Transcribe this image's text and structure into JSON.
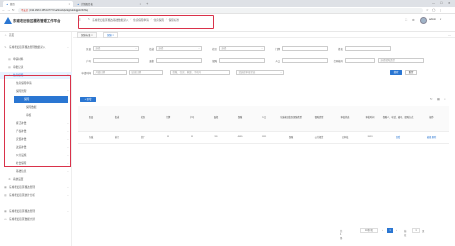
{
  "browser": {
    "tabs": [
      {
        "title": "首页",
        "active": true
      },
      {
        "title": "计划配台表",
        "active": false
      }
    ],
    "url_insecure": "不安全",
    "url": "192.168.0.155:10777/zxahbx/dqh/dqjzsk/dqjgsh/zbhhq"
  },
  "app": {
    "title": "东城老旧街区棚改管理工作平台",
    "breadcrumb": [
      "东城老旧街区棚改基础数据录入",
      "住房保障申请",
      "住房保障",
      "保障标准"
    ],
    "user": "admin"
  },
  "sidebar": {
    "items": [
      {
        "label": "首页",
        "icon": "home-icon",
        "level": 0,
        "state": ""
      },
      {
        "label": "东城老旧街区棚改管理数据录入",
        "icon": "edit-icon",
        "level": 0,
        "state": "",
        "chevron": "⌄"
      },
      {
        "label": "申请材料",
        "icon": "doc-icon",
        "level": 1,
        "state": ""
      },
      {
        "label": "审批记录",
        "icon": "doc-icon",
        "level": 1,
        "state": ""
      },
      {
        "label": "住房保障",
        "icon": "house-icon",
        "level": 1,
        "state": "active",
        "chevron": "⌃"
      },
      {
        "label": "住房保障申请",
        "icon": "",
        "level": 2,
        "state": ""
      },
      {
        "label": "保障管理",
        "icon": "",
        "level": 2,
        "state": "",
        "chevron": "⌃"
      },
      {
        "label": "保障",
        "icon": "",
        "level": 3,
        "state": "activeleaf"
      },
      {
        "label": "保障数据",
        "icon": "",
        "level": 3,
        "state": ""
      },
      {
        "label": "审核",
        "icon": "",
        "level": 3,
        "state": ""
      },
      {
        "label": "拆迁补偿",
        "icon": "",
        "level": 2,
        "state": "",
        "chevron": "⌄"
      },
      {
        "label": "产权补偿",
        "icon": "",
        "level": 2,
        "state": "",
        "chevron": "⌄"
      },
      {
        "label": "安置补偿",
        "icon": "",
        "level": 2,
        "state": "",
        "chevron": "⌄"
      },
      {
        "label": "改造补偿",
        "icon": "",
        "level": 2,
        "state": "",
        "chevron": "⌄"
      },
      {
        "label": "公共设施",
        "icon": "",
        "level": 2,
        "state": "",
        "chevron": "⌄"
      },
      {
        "label": "社会保障",
        "icon": "",
        "level": 2,
        "state": "",
        "chevron": "⌄"
      },
      {
        "label": "基础信息",
        "icon": "",
        "level": 2,
        "state": "",
        "chevron": "⌄"
      },
      {
        "label": "系统设置",
        "icon": "gear-icon",
        "level": 1,
        "state": ""
      },
      {
        "label": "东城老旧街区棚改管理",
        "icon": "grid-icon",
        "level": 0,
        "state": "",
        "chevron": "⌄"
      },
      {
        "label": "东城老旧街区统计分析",
        "icon": "chart-icon",
        "level": 0,
        "state": "",
        "chevron": "⌄"
      },
      {
        "label": "东城老旧街区棚改管理",
        "icon": "grid-icon",
        "level": 0,
        "state": "",
        "chevron": "⌄"
      },
      {
        "label": "东城老旧街区数据大屏",
        "icon": "screen-icon",
        "level": 0,
        "state": ""
      }
    ]
  },
  "page_tabs": [
    {
      "label": "保障标准 ×",
      "active": false
    },
    {
      "label": "保障 ×",
      "active": true
    }
  ],
  "filters": {
    "row1": [
      {
        "label": "区县",
        "value": "选择",
        "dropdown": true
      },
      {
        "label": "街道",
        "value": "选择",
        "dropdown": true
      },
      {
        "label": "社区",
        "value": "选择",
        "dropdown": true
      },
      {
        "label": "门牌",
        "value": "",
        "dropdown": false
      },
      {
        "label": "姓名",
        "value": "",
        "dropdown": false
      }
    ],
    "row2": [
      {
        "label": "户号",
        "value": "",
        "dropdown": false
      },
      {
        "label": "面积",
        "value": "",
        "dropdown": false
      },
      {
        "label": "保障",
        "value": "",
        "dropdown": false
      },
      {
        "label": "人口",
        "value": "",
        "dropdown": false
      },
      {
        "label": "合同编号",
        "value": "",
        "dropdown": false
      },
      {
        "label": "",
        "value": "选择保障类型",
        "dropdown": false
      }
    ],
    "row3": [
      {
        "label": "申请时间",
        "value": "开始日期",
        "dropdown": false
      },
      {
        "label": "",
        "value": "结束日期",
        "dropdown": false
      },
      {
        "label": "",
        "value": "保障、住房、家庭、手机号",
        "dropdown": false
      },
      {
        "label": "",
        "value": "请选择审批状态",
        "dropdown": true
      }
    ],
    "search_button": "搜索",
    "reset_button": "重置"
  },
  "add_button": "+ 新增",
  "table": {
    "headers": [
      "区县",
      "街道",
      "社区",
      "门牌",
      "户号",
      "面积",
      "保障",
      "人口",
      "东城老旧街区保障类型",
      "保障类型",
      "审核状态",
      "审批时间",
      "保障人、电话、编号、保障方式",
      "操作"
    ],
    "rows": [
      [
        "东城",
        "前门",
        "草厂",
        "11",
        "11",
        "111",
        "4555",
        "1111",
        "保障",
        "公共租赁",
        "已审核",
        "2023",
        "查看",
        "编辑 删除"
      ]
    ]
  },
  "pager": {
    "total": "共 1 条",
    "page_size": "10条/页",
    "prev": "‹",
    "current": "1",
    "next": "›",
    "goto_label": "前往",
    "goto_value": "1",
    "goto_suffix": "页"
  }
}
